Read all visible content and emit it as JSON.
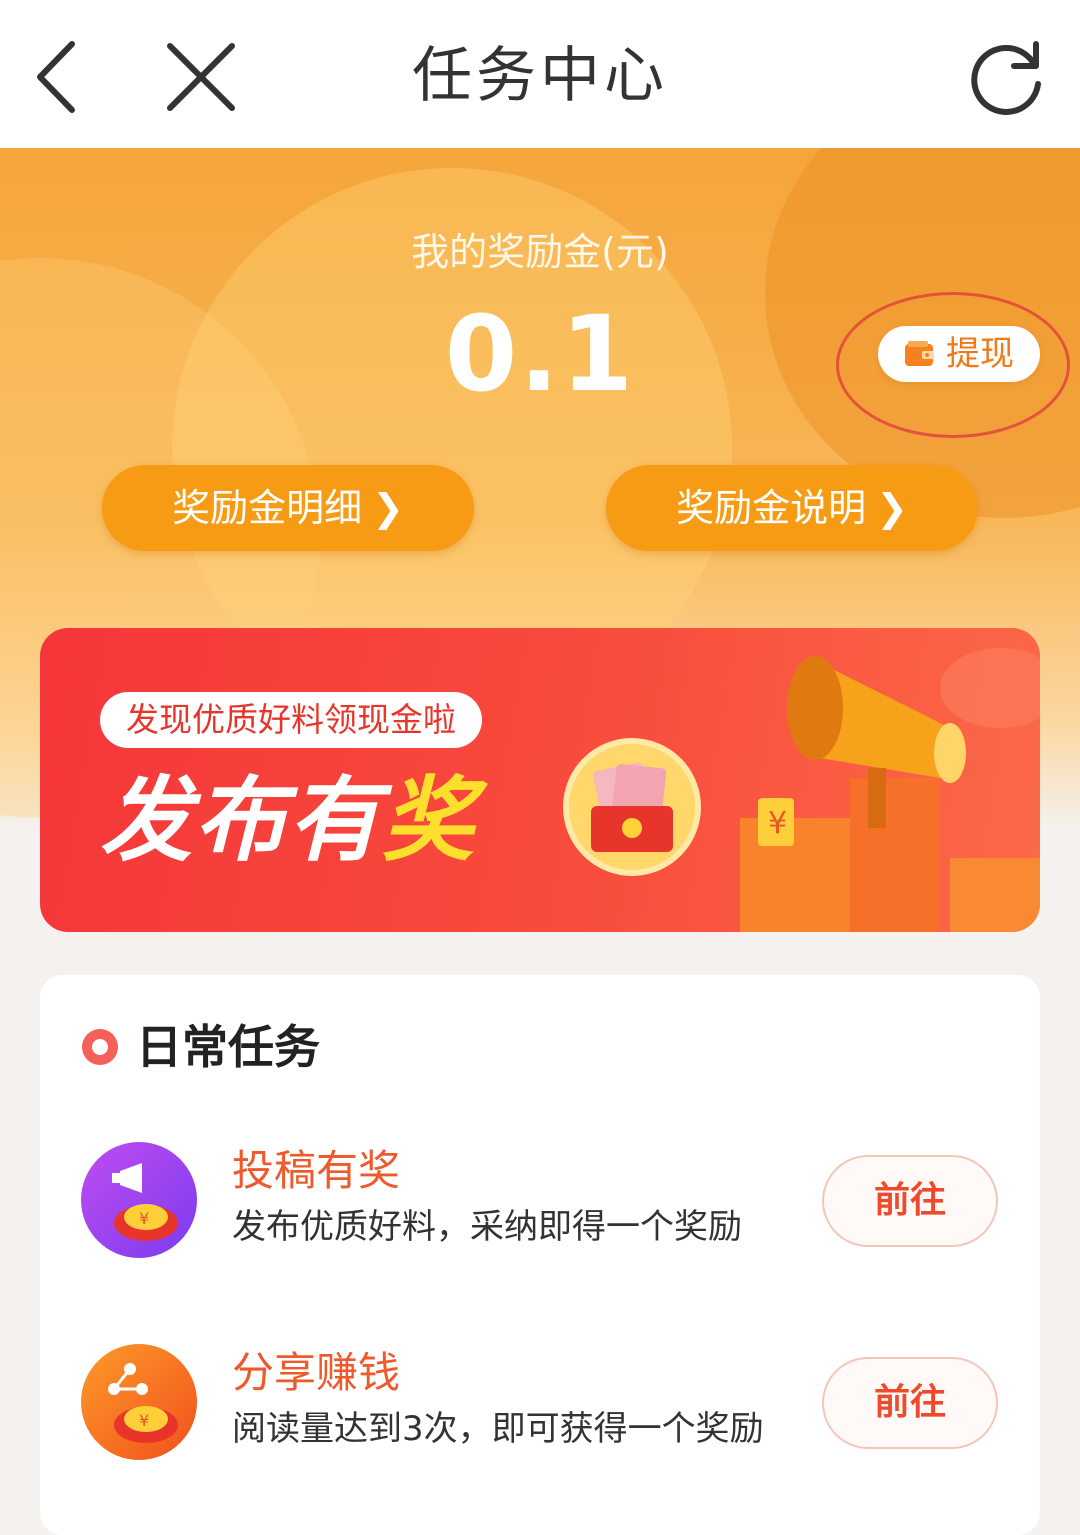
{
  "header": {
    "title": "任务中心"
  },
  "reward": {
    "label": "我的奖励金(元)",
    "amount": "0.1",
    "withdraw_label": "提现"
  },
  "links": {
    "details_label": "奖励金明细",
    "rules_label": "奖励金说明"
  },
  "banner": {
    "tag": "发现优质好料领现金啦",
    "headline_white": "发布有",
    "headline_yellow": "奖"
  },
  "daily": {
    "title": "日常任务",
    "tasks": [
      {
        "name": "投稿有奖",
        "desc": "发布优质好料，采纳即得一个奖励",
        "action": "前往"
      },
      {
        "name": "分享赚钱",
        "desc": "阅读量达到3次，即可获得一个奖励",
        "action": "前往"
      }
    ]
  },
  "colors": {
    "accent_orange": "#f79a14",
    "banner_red": "#f5363a",
    "task_name": "#ef5a2c"
  }
}
